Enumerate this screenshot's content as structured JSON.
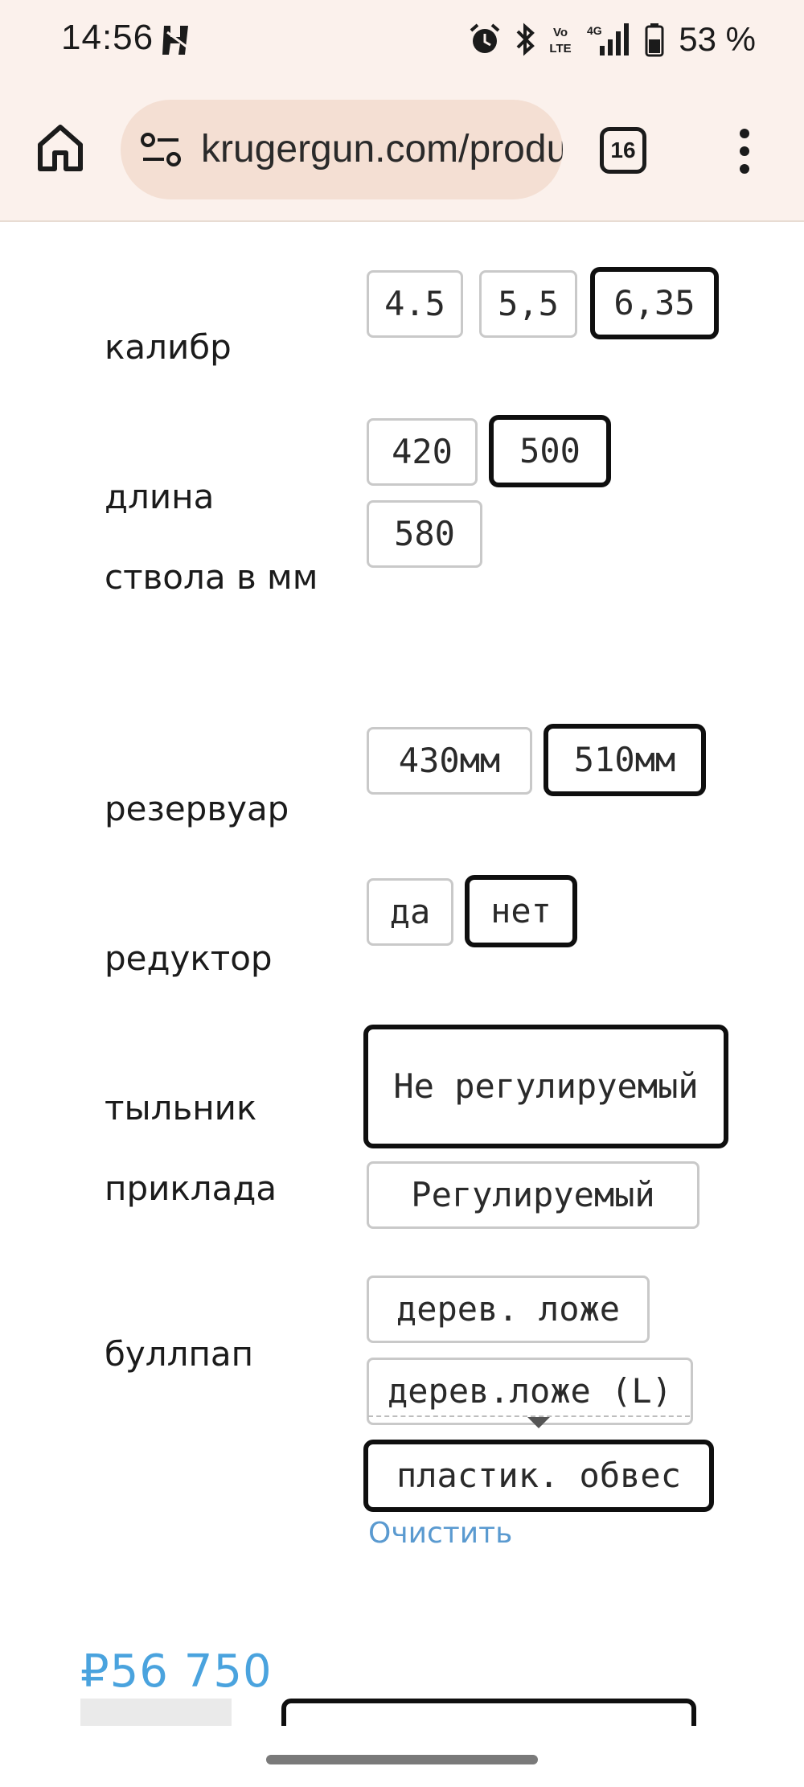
{
  "status_bar": {
    "time": "14:56",
    "battery_percent": "53 %",
    "icons": [
      "h-app-icon",
      "alarm-icon",
      "bluetooth-icon",
      "volte-icon",
      "4g-signal-icon",
      "battery-icon"
    ]
  },
  "browser": {
    "url": "krugergun.com/product",
    "tab_count": "16",
    "icons": [
      "home-icon",
      "site-settings-icon",
      "tabs-icon",
      "more-menu-icon"
    ]
  },
  "attributes": [
    {
      "label": "калибр",
      "options": [
        "4.5",
        "5,5",
        "6,35"
      ],
      "selected": "6,35"
    },
    {
      "label": "длина ствола в мм",
      "options": [
        "420",
        "500",
        "580"
      ],
      "selected": "500"
    },
    {
      "label": "резервуар",
      "options": [
        "430мм",
        "510мм"
      ],
      "selected": "510мм"
    },
    {
      "label": "редуктор",
      "options": [
        "да",
        "нет"
      ],
      "selected": "нет"
    },
    {
      "label": "тыльник приклада",
      "options": [
        "Не регулируемый",
        "Регулируемый"
      ],
      "selected": "Не регулируемый"
    },
    {
      "label": "буллпап",
      "options": [
        "дерев. ложе",
        "дерев.ложе (L)",
        "пластик. обвес"
      ],
      "selected": "пластик. обвес"
    }
  ],
  "clear_label": "Очистить",
  "price": "₽56 750",
  "colors": {
    "browser_bg": "#fbf1ec",
    "url_pill": "#f4dfd3",
    "price": "#4aa3de",
    "link": "#5a9ad0",
    "selected_border": "#0f0f0f",
    "unselected_border": "#c9c9c9"
  }
}
